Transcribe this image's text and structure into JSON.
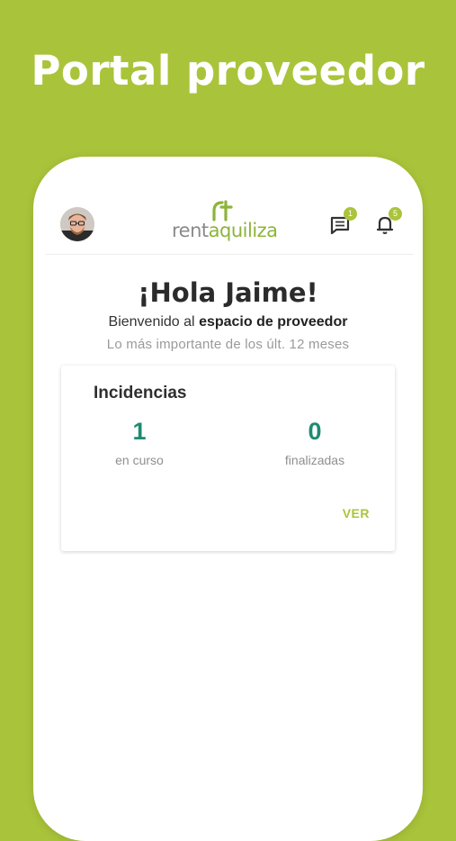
{
  "headline": "Portal proveedor",
  "app": {
    "logo": {
      "part1": "rent",
      "part2": "aquiliza"
    },
    "messages_badge": "1",
    "notifications_badge": "5"
  },
  "greeting": "¡Hola Jaime!",
  "welcome": {
    "prefix": "Bienvenido al",
    "emphasis": "espacio de proveedor"
  },
  "subtitle": "Lo más importante de los últ. 12 meses",
  "card": {
    "title": "Incidencias",
    "stats": [
      {
        "value": "1",
        "label": "en curso"
      },
      {
        "value": "0",
        "label": "finalizadas"
      }
    ],
    "action": "VER"
  },
  "colors": {
    "brand_green": "#a9c43a",
    "stat_teal": "#1e8b73"
  }
}
